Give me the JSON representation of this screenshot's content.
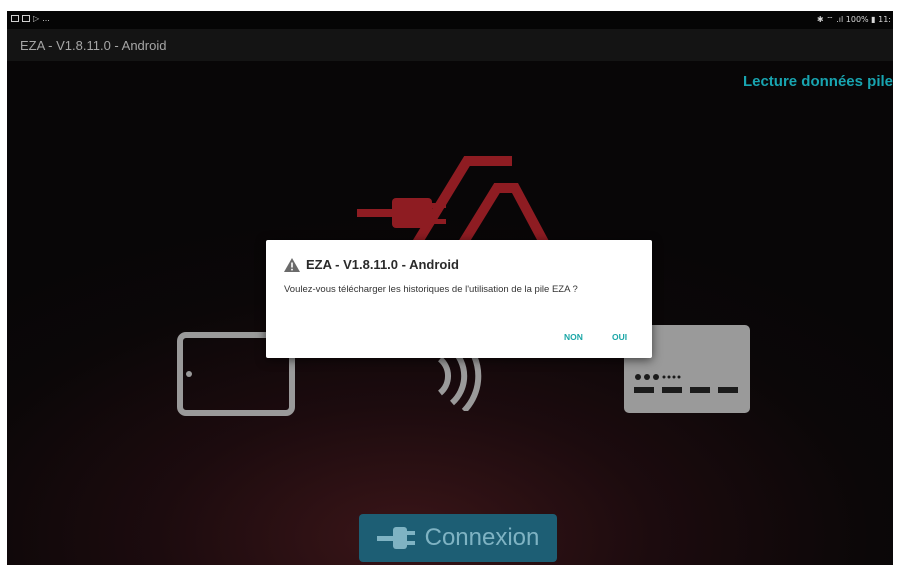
{
  "status_bar": {
    "right_text": "✱ ⌔ .ıl 100% ▮ 11:",
    "left_icons": [
      "image-icon",
      "cast-icon",
      "play-store-icon",
      "more-icon"
    ],
    "more_text": "..."
  },
  "app": {
    "title": "EZA - V1.8.11.0 - Android",
    "mode_label": "Lecture données pile"
  },
  "connect_button": {
    "label": "Connexion"
  },
  "dialog": {
    "title": "EZA - V1.8.11.0 - Android",
    "message": "Voulez-vous télécharger les historiques de l'utilisation de la pile EZA ?",
    "no_label": "NON",
    "yes_label": "OUI"
  },
  "colors": {
    "accent": "#18a4b0",
    "logo_red": "#8e1c22",
    "button_bg": "#1d5e74",
    "device_grey": "#9a9a9a"
  }
}
